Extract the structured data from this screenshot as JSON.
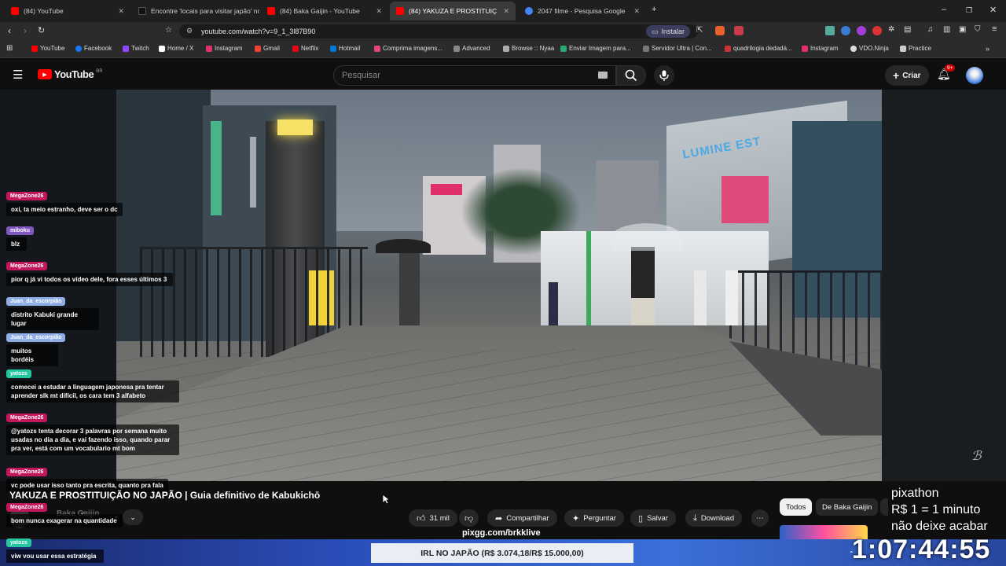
{
  "tabs": [
    {
      "label": "(84) YouTube",
      "color": "#ff0000"
    },
    {
      "label": "Encontre 'locais para visitar japão' no",
      "color": "#111111"
    },
    {
      "label": "(84) Baka Gaijin - YouTube",
      "color": "#ff0000"
    },
    {
      "label": "(84) YAKUZA E PROSTITUIÇÃO",
      "color": "#ff0000"
    },
    {
      "label": "2047 filme - Pesquisa Google",
      "color": "#4285f4"
    }
  ],
  "address": {
    "url": "youtube.com/watch?v=9_1_3l87B90",
    "install_label": "Instalar"
  },
  "bookmarks": [
    {
      "label": "YouTube",
      "color": "#ff0000"
    },
    {
      "label": "Facebook",
      "color": "#1877f2"
    },
    {
      "label": "Twitch",
      "color": "#9146ff"
    },
    {
      "label": "Home / X",
      "color": "#ffffff"
    },
    {
      "label": "Instagram",
      "color": "#e1306c"
    },
    {
      "label": "Gmail",
      "color": "#ea4335"
    },
    {
      "label": "Netflix",
      "color": "#e50914"
    },
    {
      "label": "Hotmail",
      "color": "#0078d4"
    },
    {
      "label": "Comprima imagens...",
      "color": "#e0457b"
    },
    {
      "label": "Advanced",
      "color": "#888888"
    },
    {
      "label": "Browse :: Nyaa",
      "color": "#aaaaaa"
    },
    {
      "label": "Enviar Imagem para...",
      "color": "#2aa876"
    },
    {
      "label": "Servidor Ultra | Con...",
      "color": "#777777"
    },
    {
      "label": "quadrilogia dedadá...",
      "color": "#cc3333"
    },
    {
      "label": "Instagram",
      "color": "#e1306c"
    },
    {
      "label": "VDO.Ninja",
      "color": "#dddddd"
    },
    {
      "label": "Practice",
      "color": "#cccccc"
    }
  ],
  "youtube": {
    "logo": "YouTube",
    "region": "BR",
    "search_placeholder": "Pesquisar",
    "create_label": "Criar",
    "notif_count": "9+"
  },
  "chat": [
    {
      "user": "MegaZone26",
      "color": "#c2185b",
      "msg": "oxi, ta meio estranho, deve ser o dc"
    },
    {
      "user": "miboku",
      "color": "#7e57c2",
      "msg": "blz"
    },
    {
      "user": "MegaZone26",
      "color": "#c2185b",
      "msg": "pior q já vi todos os vídeo dele, fora esses últimos 3"
    },
    {
      "user": "Juan_da_escorpião",
      "color": "#8faee6",
      "msg": "distrito Kabuki grande lugar"
    },
    {
      "user": "Juan_da_escorpião",
      "color": "#8faee6",
      "msg": "muitos bordéis"
    },
    {
      "user": "yatozs",
      "color": "#26c6a0",
      "msg": "comecei a estudar a linguagem japonesa pra tentar aprender slk mt difícil, os cara tem 3 alfabeto"
    },
    {
      "user": "MegaZone26",
      "color": "#c2185b",
      "msg": "@yatozs tenta decorar 3 palavras por semana muito usadas no dia a dia, e vai fazendo isso, quando parar pra ver, está com um vocabulario mt bom"
    },
    {
      "user": "MegaZone26",
      "color": "#c2185b",
      "msg": "vc pode usar isso tanto pra escrita, quanto pra fala"
    },
    {
      "user": "MegaZone26",
      "color": "#c2185b",
      "msg": "bom nunca exagerar na quantidade"
    },
    {
      "user": "yatozs",
      "color": "#26c6a0",
      "msg": "viw vou usar essa estratégia"
    }
  ],
  "video": {
    "title": "YAKUZA E PROSTITUIÇÃO NO JAPÃO | Guia definitivo de Kabukichō",
    "channel": "Baka Gaijin",
    "like_count": "31 mil",
    "share": "Compartilhar",
    "ask": "Perguntar",
    "save": "Salvar",
    "download": "Download",
    "sign_text": "LUMINE EST"
  },
  "chips": [
    "Todos",
    "De Baka Gaijin"
  ],
  "overlay": {
    "pix_line1": "pixathon",
    "pix_line2": "R$ 1 = 1 minuto",
    "pix_line3": "não deixe acabar",
    "timer": "1:07:44:55",
    "pixgg": "pixgg.com/brkklive",
    "goal": "IRL NO JAPÃO (R$ 3.074,18/R$ 15.000,00)"
  }
}
